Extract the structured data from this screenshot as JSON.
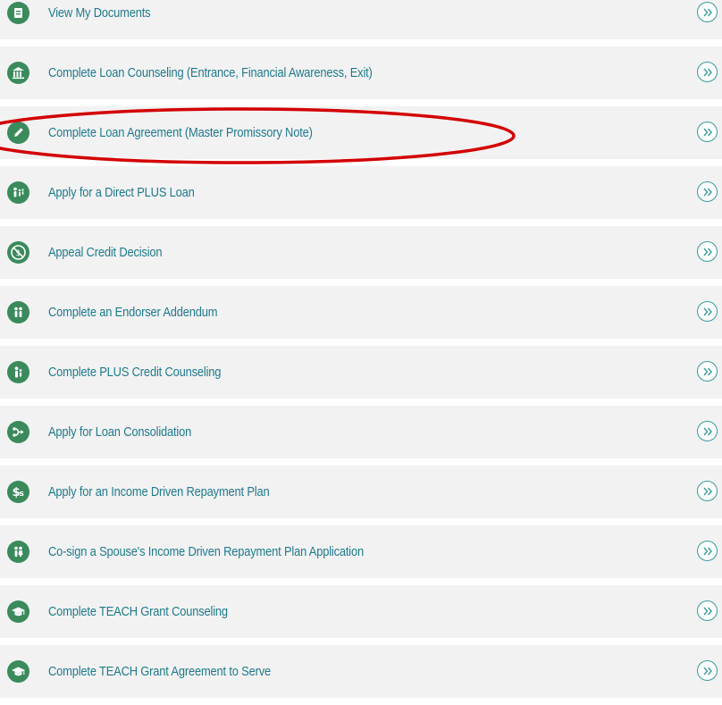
{
  "colors": {
    "link_text": "#1f7a8c",
    "icon_green": "#3a8a5c",
    "row_background": "#f2f2f2",
    "chevron_border": "#3a9a9a",
    "highlight_red": "#d40000"
  },
  "actions": [
    {
      "label": "View My Documents",
      "icon": "document-icon"
    },
    {
      "label": "Complete Loan Counseling (Entrance, Financial Awareness, Exit)",
      "icon": "bank-building-icon"
    },
    {
      "label": "Complete Loan Agreement (Master Promissory Note)",
      "icon": "pencil-icon",
      "highlighted": true
    },
    {
      "label": "Apply for a Direct PLUS Loan",
      "icon": "family-icon"
    },
    {
      "label": "Appeal Credit Decision",
      "icon": "no-dollar-icon"
    },
    {
      "label": "Complete an Endorser Addendum",
      "icon": "two-people-icon"
    },
    {
      "label": "Complete PLUS Credit Counseling",
      "icon": "parent-child-icon"
    },
    {
      "label": "Apply for Loan Consolidation",
      "icon": "merge-arrows-icon"
    },
    {
      "label": "Apply for an Income Driven Repayment Plan",
      "icon": "dollar-sign-icon"
    },
    {
      "label": "Co-sign a Spouse's Income Driven Repayment Plan Application",
      "icon": "couple-icon"
    },
    {
      "label": "Complete TEACH Grant Counseling",
      "icon": "graduation-cap-icon"
    },
    {
      "label": "Complete TEACH Grant Agreement to Serve",
      "icon": "graduation-cap-icon"
    }
  ]
}
